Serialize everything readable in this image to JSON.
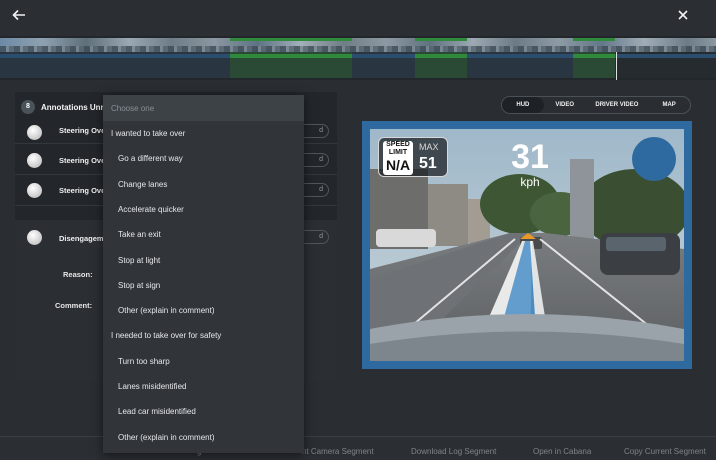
{
  "topbar": {
    "back_icon": "arrow-left-icon",
    "close_icon": "close-icon"
  },
  "colors": {
    "segment_green": "#2f8a3c",
    "segment_blue": "#2b4d6e",
    "video_border": "#2e6aa0",
    "panel": "#23272b"
  },
  "annotations": {
    "count": "8",
    "title": "Annotations Unres",
    "rows": [
      {
        "label": "Steering Over",
        "pill": "d"
      },
      {
        "label": "Steering Over",
        "pill": "d"
      },
      {
        "label": "Steering Over",
        "pill": "d"
      },
      {
        "label": "Disengageme",
        "pill": "d"
      }
    ],
    "reason_label": "Reason:",
    "comment_label": "Comment:"
  },
  "view_tabs": [
    "HUD",
    "VIDEO",
    "DRIVER VIDEO",
    "MAP"
  ],
  "active_tab": "HUD",
  "hud": {
    "speed_limit_line1": "SPEED",
    "speed_limit_line2": "LIMIT",
    "speed_limit_value": "N/A",
    "max_label": "MAX",
    "max_value": "51",
    "speed": "31",
    "unit": "kph"
  },
  "dropdown": {
    "placeholder": "Choose one",
    "items": [
      {
        "label": "I wanted to take over",
        "kind": "group"
      },
      {
        "label": "Go a different way",
        "kind": "sub"
      },
      {
        "label": "Change lanes",
        "kind": "sub"
      },
      {
        "label": "Accelerate quicker",
        "kind": "sub"
      },
      {
        "label": "Take an exit",
        "kind": "sub"
      },
      {
        "label": "Stop at light",
        "kind": "sub"
      },
      {
        "label": "Stop at sign",
        "kind": "sub"
      },
      {
        "label": "Other (explain in comment)",
        "kind": "sub"
      },
      {
        "label": "I needed to take over for safety",
        "kind": "group"
      },
      {
        "label": "Turn too sharp",
        "kind": "sub"
      },
      {
        "label": "Lanes misidentified",
        "kind": "sub"
      },
      {
        "label": "Lead car misidentified",
        "kind": "sub"
      },
      {
        "label": "Other (explain in comment)",
        "kind": "sub"
      }
    ]
  },
  "footer": {
    "links": [
      "g",
      "nt Camera Segment",
      "Download Log Segment",
      "Open in Cabana",
      "Copy Current Segment"
    ]
  }
}
